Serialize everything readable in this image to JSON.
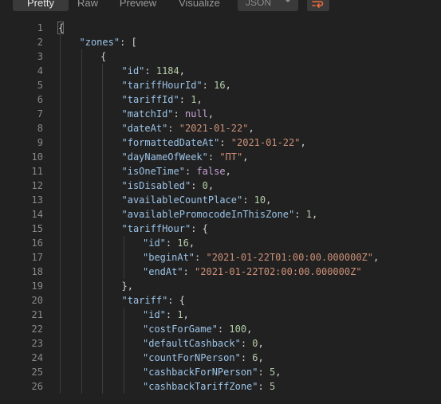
{
  "toolbar": {
    "tabs": [
      {
        "label": "Pretty",
        "active": true
      },
      {
        "label": "Raw",
        "active": false
      },
      {
        "label": "Preview",
        "active": false
      },
      {
        "label": "Visualize",
        "active": false
      }
    ],
    "format_select": "JSON",
    "wrap_icon": "wrap-lines-icon",
    "accent_color": "#f26b3a"
  },
  "editor": {
    "lines": [
      {
        "n": "1",
        "indent": 0,
        "t": [
          [
            "p",
            "{"
          ]
        ]
      },
      {
        "n": "2",
        "indent": 1,
        "t": [
          [
            "k",
            "\"zones\""
          ],
          [
            "p",
            ": ["
          ]
        ]
      },
      {
        "n": "3",
        "indent": 2,
        "t": [
          [
            "p",
            "{"
          ]
        ]
      },
      {
        "n": "4",
        "indent": 3,
        "t": [
          [
            "k",
            "\"id\""
          ],
          [
            "p",
            ": "
          ],
          [
            "n",
            "1184"
          ],
          [
            "p",
            ","
          ]
        ]
      },
      {
        "n": "5",
        "indent": 3,
        "t": [
          [
            "k",
            "\"tariffHourId\""
          ],
          [
            "p",
            ": "
          ],
          [
            "n",
            "16"
          ],
          [
            "p",
            ","
          ]
        ]
      },
      {
        "n": "6",
        "indent": 3,
        "t": [
          [
            "k",
            "\"tariffId\""
          ],
          [
            "p",
            ": "
          ],
          [
            "n",
            "1"
          ],
          [
            "p",
            ","
          ]
        ]
      },
      {
        "n": "7",
        "indent": 3,
        "t": [
          [
            "k",
            "\"matchId\""
          ],
          [
            "p",
            ": "
          ],
          [
            "kw",
            "null"
          ],
          [
            "p",
            ","
          ]
        ]
      },
      {
        "n": "8",
        "indent": 3,
        "t": [
          [
            "k",
            "\"dateAt\""
          ],
          [
            "p",
            ": "
          ],
          [
            "s",
            "\"2021-01-22\""
          ],
          [
            "p",
            ","
          ]
        ]
      },
      {
        "n": "9",
        "indent": 3,
        "t": [
          [
            "k",
            "\"formattedDateAt\""
          ],
          [
            "p",
            ": "
          ],
          [
            "s",
            "\"2021-01-22\""
          ],
          [
            "p",
            ","
          ]
        ]
      },
      {
        "n": "10",
        "indent": 3,
        "t": [
          [
            "k",
            "\"dayNameOfWeek\""
          ],
          [
            "p",
            ": "
          ],
          [
            "s",
            "\"ПТ\""
          ],
          [
            "p",
            ","
          ]
        ]
      },
      {
        "n": "11",
        "indent": 3,
        "t": [
          [
            "k",
            "\"isOneTime\""
          ],
          [
            "p",
            ": "
          ],
          [
            "kw",
            "false"
          ],
          [
            "p",
            ","
          ]
        ]
      },
      {
        "n": "12",
        "indent": 3,
        "t": [
          [
            "k",
            "\"isDisabled\""
          ],
          [
            "p",
            ": "
          ],
          [
            "n",
            "0"
          ],
          [
            "p",
            ","
          ]
        ]
      },
      {
        "n": "13",
        "indent": 3,
        "t": [
          [
            "k",
            "\"availableCountPlace\""
          ],
          [
            "p",
            ": "
          ],
          [
            "n",
            "10"
          ],
          [
            "p",
            ","
          ]
        ]
      },
      {
        "n": "14",
        "indent": 3,
        "t": [
          [
            "k",
            "\"availablePromocodeInThisZone\""
          ],
          [
            "p",
            ": "
          ],
          [
            "n",
            "1"
          ],
          [
            "p",
            ","
          ]
        ]
      },
      {
        "n": "15",
        "indent": 3,
        "t": [
          [
            "k",
            "\"tariffHour\""
          ],
          [
            "p",
            ": {"
          ]
        ]
      },
      {
        "n": "16",
        "indent": 4,
        "t": [
          [
            "k",
            "\"id\""
          ],
          [
            "p",
            ": "
          ],
          [
            "n",
            "16"
          ],
          [
            "p",
            ","
          ]
        ]
      },
      {
        "n": "17",
        "indent": 4,
        "t": [
          [
            "k",
            "\"beginAt\""
          ],
          [
            "p",
            ": "
          ],
          [
            "s",
            "\"2021-01-22T01:00:00.000000Z\""
          ],
          [
            "p",
            ","
          ]
        ]
      },
      {
        "n": "18",
        "indent": 4,
        "t": [
          [
            "k",
            "\"endAt\""
          ],
          [
            "p",
            ": "
          ],
          [
            "s",
            "\"2021-01-22T02:00:00.000000Z\""
          ]
        ]
      },
      {
        "n": "19",
        "indent": 3,
        "t": [
          [
            "p",
            "},"
          ]
        ]
      },
      {
        "n": "20",
        "indent": 3,
        "t": [
          [
            "k",
            "\"tariff\""
          ],
          [
            "p",
            ": {"
          ]
        ]
      },
      {
        "n": "21",
        "indent": 4,
        "t": [
          [
            "k",
            "\"id\""
          ],
          [
            "p",
            ": "
          ],
          [
            "n",
            "1"
          ],
          [
            "p",
            ","
          ]
        ]
      },
      {
        "n": "22",
        "indent": 4,
        "t": [
          [
            "k",
            "\"costForGame\""
          ],
          [
            "p",
            ": "
          ],
          [
            "n",
            "100"
          ],
          [
            "p",
            ","
          ]
        ]
      },
      {
        "n": "23",
        "indent": 4,
        "t": [
          [
            "k",
            "\"defaultCashback\""
          ],
          [
            "p",
            ": "
          ],
          [
            "n",
            "0"
          ],
          [
            "p",
            ","
          ]
        ]
      },
      {
        "n": "24",
        "indent": 4,
        "t": [
          [
            "k",
            "\"countForNPerson\""
          ],
          [
            "p",
            ": "
          ],
          [
            "n",
            "6"
          ],
          [
            "p",
            ","
          ]
        ]
      },
      {
        "n": "25",
        "indent": 4,
        "t": [
          [
            "k",
            "\"cashbackForNPerson\""
          ],
          [
            "p",
            ": "
          ],
          [
            "n",
            "5"
          ],
          [
            "p",
            ","
          ]
        ]
      },
      {
        "n": "26",
        "indent": 4,
        "t": [
          [
            "k",
            "\"cashbackTariffZone\""
          ],
          [
            "p",
            ": "
          ],
          [
            "n",
            "5"
          ]
        ]
      }
    ]
  }
}
